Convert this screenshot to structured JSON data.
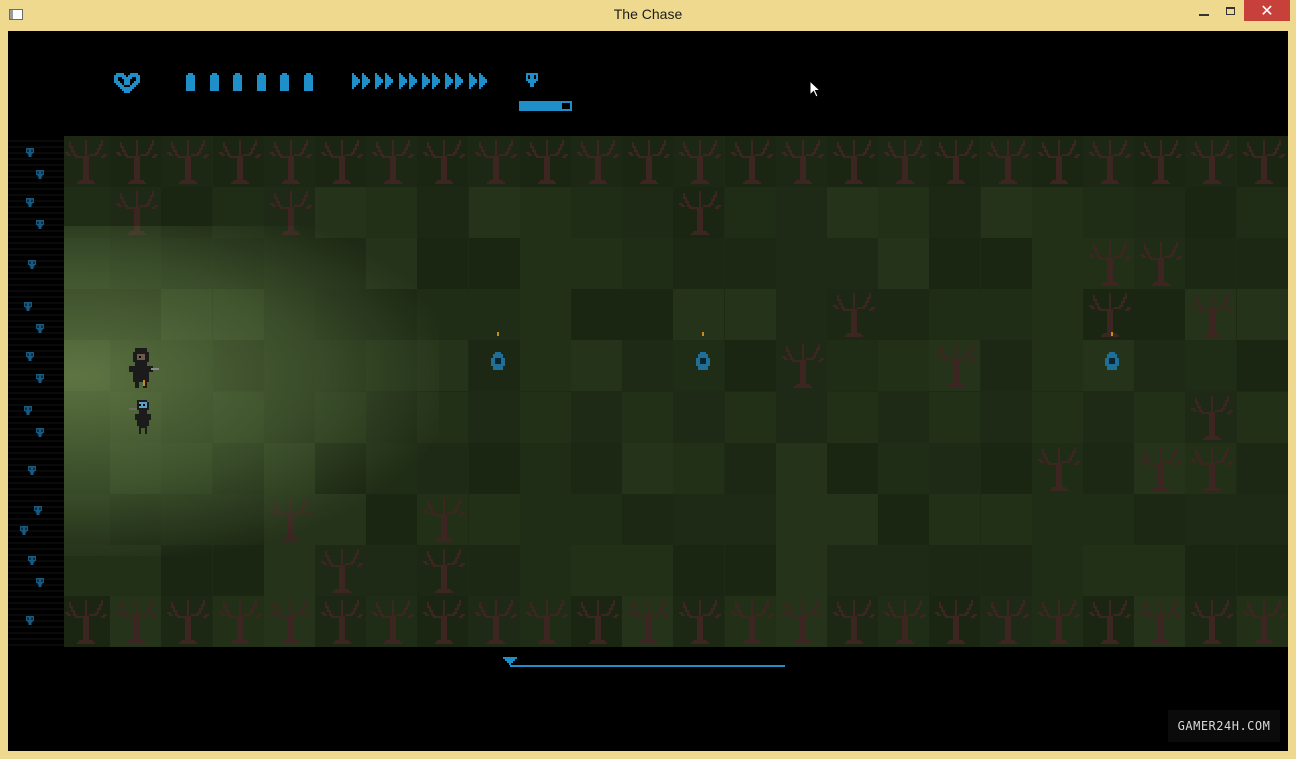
{
  "window": {
    "title": "The Chase",
    "controls": {
      "minimize": "minimize",
      "maximize": "maximize",
      "close": "✕"
    }
  },
  "hud": {
    "health_icon": "heart-icon",
    "ammo_count": 6,
    "ammo_icon": "bullet-icon",
    "speed_count": 6,
    "speed_icon": "fast-forward-icon",
    "enemy_icon": "skull-icon",
    "enemy_bar_fraction": 0.83
  },
  "map": {
    "theme": "dead forest",
    "progress_fraction": 0.03
  },
  "colors": {
    "accent": "#1f8fc9",
    "background": "#000000",
    "ground_dark": "#1d2a15",
    "ground_light": "#4a5d34",
    "tree": "#3d2622"
  },
  "watermark": "GAMER24H.COM"
}
